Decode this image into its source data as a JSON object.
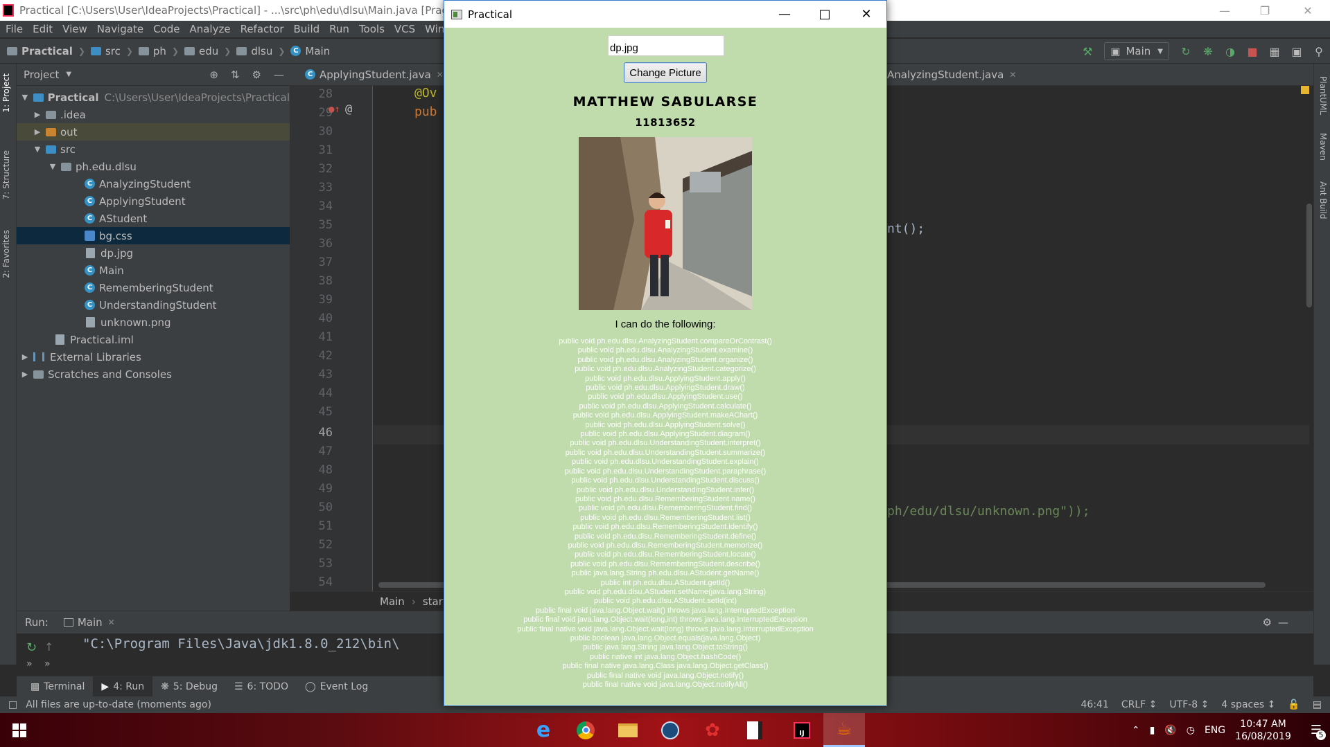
{
  "ide": {
    "title": "Practical [C:\\Users\\User\\IdeaProjects\\Practical] - ...\\src\\ph\\edu\\dlsu\\Main.java [Practical] - IntelliJ IDEA",
    "menu": [
      "File",
      "Edit",
      "View",
      "Navigate",
      "Code",
      "Analyze",
      "Refactor",
      "Build",
      "Run",
      "Tools",
      "VCS",
      "Window"
    ],
    "nav": {
      "project": "Practical",
      "crumbs": [
        "src",
        "ph",
        "edu",
        "dlsu"
      ],
      "class": "Main",
      "run_config": "Main"
    },
    "left_tabs": [
      "1: Project",
      "7: Structure",
      "2: Favorites"
    ],
    "right_tabs": [
      "PlantUML",
      "Maven",
      "Ant Build"
    ],
    "project_panel": {
      "title": "Project",
      "root": "Practical",
      "root_path": "C:\\Users\\User\\IdeaProjects\\Practical",
      "items": [
        {
          "label": ".idea"
        },
        {
          "label": "out"
        },
        {
          "label": "src"
        },
        {
          "label": "ph.edu.dlsu"
        },
        {
          "label": "AnalyzingStudent"
        },
        {
          "label": "ApplyingStudent"
        },
        {
          "label": "AStudent"
        },
        {
          "label": "bg.css"
        },
        {
          "label": "dp.jpg"
        },
        {
          "label": "Main"
        },
        {
          "label": "RememberingStudent"
        },
        {
          "label": "UnderstandingStudent"
        },
        {
          "label": "unknown.png"
        },
        {
          "label": "Practical.iml"
        },
        {
          "label": "External Libraries"
        },
        {
          "label": "Scratches and Consoles"
        }
      ]
    },
    "editor": {
      "tabs": [
        "ApplyingStudent.java",
        "AnalyzingStudent.java"
      ],
      "line_numbers": [
        "28",
        "29",
        "30",
        "31",
        "32",
        "33",
        "34",
        "35",
        "36",
        "37",
        "38",
        "39",
        "40",
        "41",
        "42",
        "43",
        "44",
        "45",
        "46",
        "47",
        "48",
        "49",
        "50",
        "51",
        "52",
        "53",
        "54"
      ],
      "current_line": "46",
      "code_override": "@Ov",
      "code_public": "pub",
      "code_fragment_1": "nt();",
      "code_fragment_2": "ph/edu/dlsu/unknown.png\"));",
      "breadcrumb": [
        "Main",
        "start"
      ]
    },
    "run": {
      "label": "Run:",
      "tab": "Main",
      "output": "\"C:\\Program Files\\Java\\jdk1.8.0_212\\bin\\"
    },
    "tool_tabs": [
      "Terminal",
      "4: Run",
      "5: Debug",
      "6: TODO",
      "Event Log"
    ],
    "status": {
      "message": "All files are up-to-date (moments ago)",
      "position": "46:41",
      "line_sep": "CRLF",
      "encoding": "UTF-8",
      "indent": "4 spaces"
    }
  },
  "app": {
    "title": "Practical",
    "picture_field": "dp.jpg",
    "change_button": "Change Picture",
    "name": "MATTHEW SABULARSE",
    "id": "11813652",
    "cando_label": "I can do the following:",
    "methods": [
      "public void ph.edu.dlsu.AnalyzingStudent.compareOrContrast()",
      "public void ph.edu.dlsu.AnalyzingStudent.examine()",
      "public void ph.edu.dlsu.AnalyzingStudent.organize()",
      "public void ph.edu.dlsu.AnalyzingStudent.categorize()",
      "public void ph.edu.dlsu.ApplyingStudent.apply()",
      "public void ph.edu.dlsu.ApplyingStudent.draw()",
      "public void ph.edu.dlsu.ApplyingStudent.use()",
      "public void ph.edu.dlsu.ApplyingStudent.calculate()",
      "public void ph.edu.dlsu.ApplyingStudent.makeAChart()",
      "public void ph.edu.dlsu.ApplyingStudent.solve()",
      "public void ph.edu.dlsu.ApplyingStudent.diagram()",
      "public void ph.edu.dlsu.UnderstandingStudent.interpret()",
      "public void ph.edu.dlsu.UnderstandingStudent.summarize()",
      "public void ph.edu.dlsu.UnderstandingStudent.explain()",
      "public void ph.edu.dlsu.UnderstandingStudent.paraphrase()",
      "public void ph.edu.dlsu.UnderstandingStudent.discuss()",
      "public void ph.edu.dlsu.UnderstandingStudent.infer()",
      "public void ph.edu.dlsu.RememberingStudent.name()",
      "public void ph.edu.dlsu.RememberingStudent.find()",
      "public void ph.edu.dlsu.RememberingStudent.list()",
      "public void ph.edu.dlsu.RememberingStudent.identify()",
      "public void ph.edu.dlsu.RememberingStudent.define()",
      "public void ph.edu.dlsu.RememberingStudent.memorize()",
      "public void ph.edu.dlsu.RememberingStudent.locate()",
      "public void ph.edu.dlsu.RememberingStudent.describe()",
      "public java.lang.String ph.edu.dlsu.AStudent.getName()",
      "public int ph.edu.dlsu.AStudent.getId()",
      "public void ph.edu.dlsu.AStudent.setName(java.lang.String)",
      "public void ph.edu.dlsu.AStudent.setId(int)",
      "public final void java.lang.Object.wait() throws java.lang.InterruptedException",
      "public final void java.lang.Object.wait(long,int) throws java.lang.InterruptedException",
      "public final native void java.lang.Object.wait(long) throws java.lang.InterruptedException",
      "public boolean java.lang.Object.equals(java.lang.Object)",
      "public java.lang.String java.lang.Object.toString()",
      "public native int java.lang.Object.hashCode()",
      "public final native java.lang.Class java.lang.Object.getClass()",
      "public final native void java.lang.Object.notify()",
      "public final native void java.lang.Object.notifyAll()"
    ]
  },
  "taskbar": {
    "lang": "ENG",
    "time": "10:47 AM",
    "date": "16/08/2019",
    "notifications": "5"
  },
  "colors": {
    "app_bg": "#c0dcad",
    "ide_bg": "#2b2b2b",
    "ide_panel": "#3c3f41",
    "selection": "#0d293e"
  }
}
